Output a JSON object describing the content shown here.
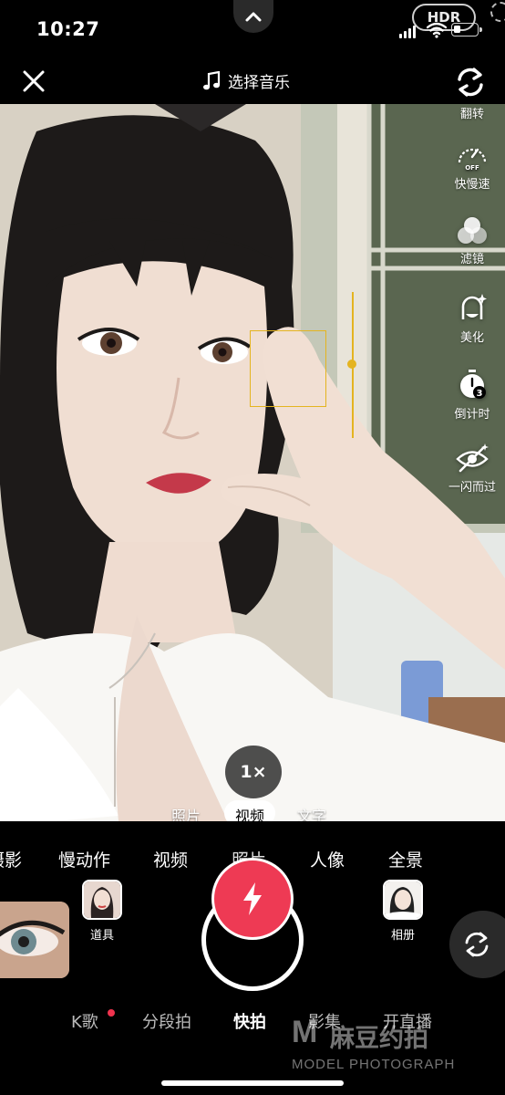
{
  "status_bar": {
    "time": "10:27",
    "hdr": "HDR",
    "battery_level": 0.3
  },
  "top_bar": {
    "music_label": "选择音乐"
  },
  "side_tools": [
    {
      "label": "翻转",
      "icon": "flip-icon"
    },
    {
      "label": "快慢速",
      "icon": "speed-icon",
      "sub": "OFF"
    },
    {
      "label": "滤镜",
      "icon": "filter-icon"
    },
    {
      "label": "美化",
      "icon": "beauty-icon"
    },
    {
      "label": "倒计时",
      "icon": "timer-icon",
      "sub": "3"
    },
    {
      "label": "一闪而过",
      "icon": "flash-off-icon"
    }
  ],
  "zoom": "1×",
  "sub_modes": [
    {
      "label": "照片",
      "active": false
    },
    {
      "label": "视频",
      "active": true
    },
    {
      "label": "文字",
      "active": false
    }
  ],
  "modes": [
    "摄影",
    "慢动作",
    "视频",
    "照片",
    "人像",
    "全景"
  ],
  "props_label": "道具",
  "album_label": "相册",
  "bottom_tabs": [
    {
      "label": "K歌",
      "active": false
    },
    {
      "label": "分段拍",
      "active": false
    },
    {
      "label": "快拍",
      "active": true
    },
    {
      "label": "影集",
      "active": false
    },
    {
      "label": "开直播",
      "active": false
    }
  ],
  "watermark": {
    "logo": "M",
    "title": "麻豆约拍",
    "subtitle": "MODEL PHOTOGRAPH"
  },
  "colors": {
    "accent_red": "#ee3a54",
    "focus_yellow": "#e4b420"
  }
}
